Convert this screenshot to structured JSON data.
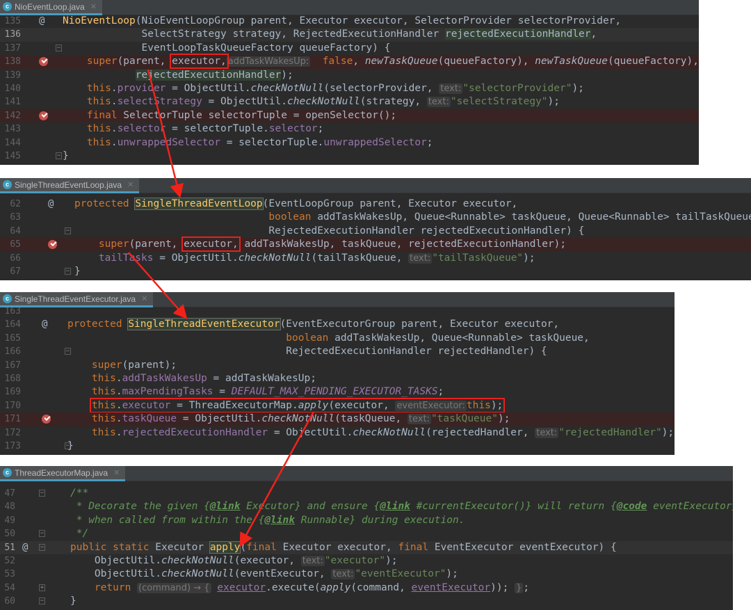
{
  "panels": [
    {
      "tab": "NioEventLoop.java",
      "rows": [
        {
          "n": "135",
          "g": "@",
          "t": [
            [
              "fn",
              "NioEventLoop"
            ],
            [
              "",
              "(NioEventLoopGroup parent, Executor executor, SelectorProvider selectorProvider,"
            ]
          ]
        },
        {
          "n": "136",
          "bg": "cur",
          "i": 13,
          "t": [
            [
              "",
              "SelectStrategy strategy, RejectedExecutionHandler "
            ],
            [
              "hg",
              "rejectedExecutionHandler"
            ],
            [
              "",
              ","
            ]
          ]
        },
        {
          "n": "137",
          "f": "close",
          "i": 13,
          "t": [
            [
              "",
              "EventLoopTaskQueueFactory queueFactory) {"
            ]
          ]
        },
        {
          "n": "138",
          "bg": "bp",
          "g": "bp",
          "i": 4,
          "t": [
            [
              "kw",
              "super"
            ],
            [
              "",
              "(parent, "
            ],
            {
              "box": [
                [
                  "",
                  "executor,"
                ]
              ]
            },
            [
              "",
              ""
            ],
            [
              "hint",
              "addTaskWakesUp:"
            ],
            [
              "",
              "  "
            ],
            [
              "kw",
              "false"
            ],
            [
              "",
              ", "
            ],
            [
              "it",
              "newTaskQueue"
            ],
            [
              "",
              "(queueFactory), "
            ],
            [
              "it",
              "newTaskQueue"
            ],
            [
              "",
              "(queueFactory),"
            ]
          ]
        },
        {
          "n": "139",
          "i": 12,
          "t": [
            [
              "hg",
              "rejectedExecutionHandler"
            ],
            [
              "",
              ");"
            ]
          ]
        },
        {
          "n": "140",
          "i": 4,
          "t": [
            [
              "kw",
              "this"
            ],
            [
              "",
              "."
            ],
            [
              "fld",
              "provider"
            ],
            [
              "",
              " = ObjectUtil."
            ],
            [
              "it",
              "checkNotNull"
            ],
            [
              "",
              "(selectorProvider, "
            ],
            [
              "hint",
              "text:"
            ],
            [
              "str",
              "\"selectorProvider\""
            ],
            [
              "",
              ");"
            ]
          ]
        },
        {
          "n": "141",
          "i": 4,
          "t": [
            [
              "kw",
              "this"
            ],
            [
              "",
              "."
            ],
            [
              "fld",
              "selectStrategy"
            ],
            [
              "",
              " = ObjectUtil."
            ],
            [
              "it",
              "checkNotNull"
            ],
            [
              "",
              "(strategy, "
            ],
            [
              "hint",
              "text:"
            ],
            [
              "str",
              "\"selectStrategy\""
            ],
            [
              "",
              ");"
            ]
          ]
        },
        {
          "n": "142",
          "bg": "bp",
          "g": "bp",
          "i": 4,
          "t": [
            [
              "kw",
              "final"
            ],
            [
              "",
              " SelectorTuple selectorTuple = openSelector();"
            ]
          ]
        },
        {
          "n": "143",
          "i": 4,
          "t": [
            [
              "kw",
              "this"
            ],
            [
              "",
              "."
            ],
            [
              "fld",
              "selector"
            ],
            [
              "",
              "",
              " "
            ],
            [
              "",
              " = selectorTuple."
            ],
            [
              "fld",
              "selector"
            ],
            [
              "",
              ";"
            ]
          ]
        },
        {
          "n": "144",
          "i": 4,
          "t": [
            [
              "kw",
              "this"
            ],
            [
              "",
              "."
            ],
            [
              "fld",
              "unwrappedSelector"
            ],
            [
              "",
              " = selectorTuple."
            ],
            [
              "fld",
              "unwrappedSelector"
            ],
            [
              "",
              ";"
            ]
          ]
        },
        {
          "n": "145",
          "f": "open",
          "t": [
            [
              "",
              "}"
            ]
          ]
        }
      ]
    },
    {
      "tab": "SingleThreadEventLoop.java",
      "rows": [
        {
          "n": "62",
          "g": "@",
          "t": [
            [
              "kw",
              "protected"
            ],
            [
              "",
              " "
            ],
            [
              "fnhl",
              "SingleThreadEventLoop"
            ],
            [
              "",
              "(EventLoopGroup parent, Executor executor,"
            ]
          ]
        },
        {
          "n": "63",
          "i": 32,
          "t": [
            [
              "kw",
              "boolean"
            ],
            [
              "",
              " addTaskWakesUp, Queue<Runnable> taskQueue, Queue<Runnable> tailTaskQueue,"
            ]
          ]
        },
        {
          "n": "64",
          "f": "close",
          "i": 32,
          "t": [
            [
              "",
              "RejectedExecutionHandler rejectedExecutionHandler) {"
            ]
          ]
        },
        {
          "n": "65",
          "bg": "bp",
          "g": "bp",
          "i": 4,
          "t": [
            [
              "kw",
              "super"
            ],
            [
              "",
              "(parent, "
            ],
            {
              "box": [
                [
                  "",
                  "executor,"
                ]
              ]
            },
            [
              "",
              " addTaskWakesUp, taskQueue, rejectedExecutionHandler);"
            ]
          ]
        },
        {
          "n": "66",
          "i": 4,
          "t": [
            [
              "fld",
              "tailTasks"
            ],
            [
              "",
              " = ObjectUtil."
            ],
            [
              "it",
              "checkNotNull"
            ],
            [
              "",
              "(tailTaskQueue, "
            ],
            [
              "hint",
              "text:"
            ],
            [
              "str",
              "\"tailTaskQueue\""
            ],
            [
              "",
              ");"
            ]
          ]
        },
        {
          "n": "67",
          "f": "open",
          "t": [
            [
              "",
              "}"
            ]
          ]
        }
      ]
    },
    {
      "tab": "SingleThreadEventExecutor.java",
      "rows": [
        {
          "n": "163",
          "t": []
        },
        {
          "n": "164",
          "g": "@",
          "t": [
            [
              "kw",
              "protected"
            ],
            [
              "",
              " "
            ],
            [
              "fnhl",
              "SingleThreadEventExecutor"
            ],
            [
              "",
              "(EventExecutorGroup parent, Executor executor,"
            ]
          ]
        },
        {
          "n": "165",
          "i": 36,
          "t": [
            [
              "kw",
              "boolean"
            ],
            [
              "",
              " addTaskWakesUp, Queue<Runnable> taskQueue,"
            ]
          ]
        },
        {
          "n": "166",
          "f": "close",
          "i": 36,
          "t": [
            [
              "",
              "RejectedExecutionHandler rejectedHandler) {"
            ]
          ]
        },
        {
          "n": "167",
          "i": 4,
          "t": [
            [
              "kw",
              "super"
            ],
            [
              "",
              "(parent);"
            ]
          ]
        },
        {
          "n": "168",
          "i": 4,
          "t": [
            [
              "kw",
              "this"
            ],
            [
              "",
              "."
            ],
            [
              "fld",
              "addTaskWakesUp"
            ],
            [
              "",
              " = addTaskWakesUp;"
            ]
          ]
        },
        {
          "n": "169",
          "i": 4,
          "t": [
            [
              "kw",
              "this"
            ],
            [
              "",
              "."
            ],
            [
              "fld",
              "maxPendingTasks"
            ],
            [
              "",
              " = "
            ],
            [
              "const",
              "DEFAULT_MAX_PENDING_EXECUTOR_TASKS"
            ],
            [
              "",
              ";"
            ]
          ]
        },
        {
          "n": "170",
          "i": 4,
          "t": [
            {
              "box": [
                [
                  "kw",
                  "this"
                ],
                [
                  "",
                  "."
                ],
                [
                  "fld",
                  "executor"
                ],
                [
                  "",
                  " = ThreadExecutorMap."
                ],
                [
                  "it",
                  "apply"
                ],
                [
                  "",
                  "(executor, "
                ],
                [
                  "hint",
                  "eventExecutor:"
                ],
                [
                  "",
                  ""
                ],
                [
                  "kw",
                  "this"
                ],
                [
                  "",
                  ");"
                ]
              ]
            }
          ]
        },
        {
          "n": "171",
          "bg": "bp",
          "g": "bp",
          "i": 4,
          "t": [
            [
              "kw",
              "this"
            ],
            [
              "",
              "."
            ],
            [
              "fld",
              "taskQueue"
            ],
            [
              "",
              " = ObjectUtil."
            ],
            [
              "it",
              "checkNotNull"
            ],
            [
              "",
              "(taskQueue, "
            ],
            [
              "hint",
              "text:"
            ],
            [
              "str",
              "\"taskQueue\""
            ],
            [
              "",
              ");"
            ]
          ]
        },
        {
          "n": "172",
          "i": 4,
          "t": [
            [
              "kw",
              "this"
            ],
            [
              "",
              "."
            ],
            [
              "fld",
              "rejectedExecutionHandler"
            ],
            [
              "",
              " = ObjectUtil."
            ],
            [
              "it",
              "checkNotNull"
            ],
            [
              "",
              "(rejectedHandler, "
            ],
            [
              "hint",
              "text:"
            ],
            [
              "str",
              "\"rejectedHandler\""
            ],
            [
              "",
              ");"
            ]
          ]
        },
        {
          "n": "173",
          "f": "open",
          "t": [
            [
              "",
              "}"
            ]
          ]
        }
      ]
    },
    {
      "tab": "ThreadExecutorMap.java",
      "rows": [
        {
          "n": "47",
          "f": "close",
          "t": [
            [
              "cm",
              "/**"
            ]
          ]
        },
        {
          "n": "48",
          "t": [
            [
              "cm",
              " * Decorate the given {"
            ],
            [
              "dt",
              "@link"
            ],
            [
              "cm",
              " Executor} and ensure {"
            ],
            [
              "dt",
              "@link"
            ],
            [
              "cm",
              " #currentExecutor()} will return {"
            ],
            [
              "dt",
              "@code"
            ],
            [
              "cm",
              " eventExecutor}"
            ]
          ]
        },
        {
          "n": "49",
          "t": [
            [
              "cm",
              " * when called from within the {"
            ],
            [
              "dt",
              "@link"
            ],
            [
              "cm",
              " Runnable} during execution."
            ]
          ]
        },
        {
          "n": "50",
          "f": "open",
          "t": [
            [
              "cm",
              " */"
            ]
          ]
        },
        {
          "n": "51",
          "bg": "cur",
          "g": "@",
          "f": "close",
          "t": [
            [
              "kw",
              "public static"
            ],
            [
              "",
              " Executor "
            ],
            [
              "fnhl",
              "apply"
            ],
            [
              "",
              "("
            ],
            [
              "kw",
              "final"
            ],
            [
              "",
              " Executor executor, "
            ],
            [
              "kw",
              "final"
            ],
            [
              "",
              " EventExecutor eventExecutor) {"
            ]
          ]
        },
        {
          "n": "52",
          "i": 4,
          "t": [
            [
              "",
              "ObjectUtil."
            ],
            [
              "it",
              "checkNotNull"
            ],
            [
              "",
              "(executor, "
            ],
            [
              "hint",
              "text:"
            ],
            [
              "str",
              "\"executor\""
            ],
            [
              "",
              ");"
            ]
          ]
        },
        {
          "n": "53",
          "i": 4,
          "t": [
            [
              "",
              "ObjectUtil."
            ],
            [
              "it",
              "checkNotNull"
            ],
            [
              "",
              "(eventExecutor, "
            ],
            [
              "hint",
              "text:"
            ],
            [
              "str",
              "\"eventExecutor\""
            ],
            [
              "",
              ");"
            ]
          ]
        },
        {
          "n": "54",
          "f": "plus",
          "i": 4,
          "t": [
            [
              "kw",
              "return"
            ],
            [
              "",
              " "
            ],
            [
              "hint",
              "(command) → {"
            ],
            [
              "",
              " "
            ],
            [
              "ul",
              "executor"
            ],
            [
              "",
              ".execute("
            ],
            [
              "it",
              "apply"
            ],
            [
              "",
              "(command, "
            ],
            [
              "ul",
              "eventExecutor"
            ],
            [
              "",
              "));"
            ],
            [
              "",
              " "
            ],
            [
              "hint",
              "}"
            ],
            [
              "",
              ";"
            ]
          ]
        },
        {
          "n": "60",
          "f": "open",
          "t": [
            [
              "",
              "}"
            ]
          ]
        }
      ]
    }
  ]
}
